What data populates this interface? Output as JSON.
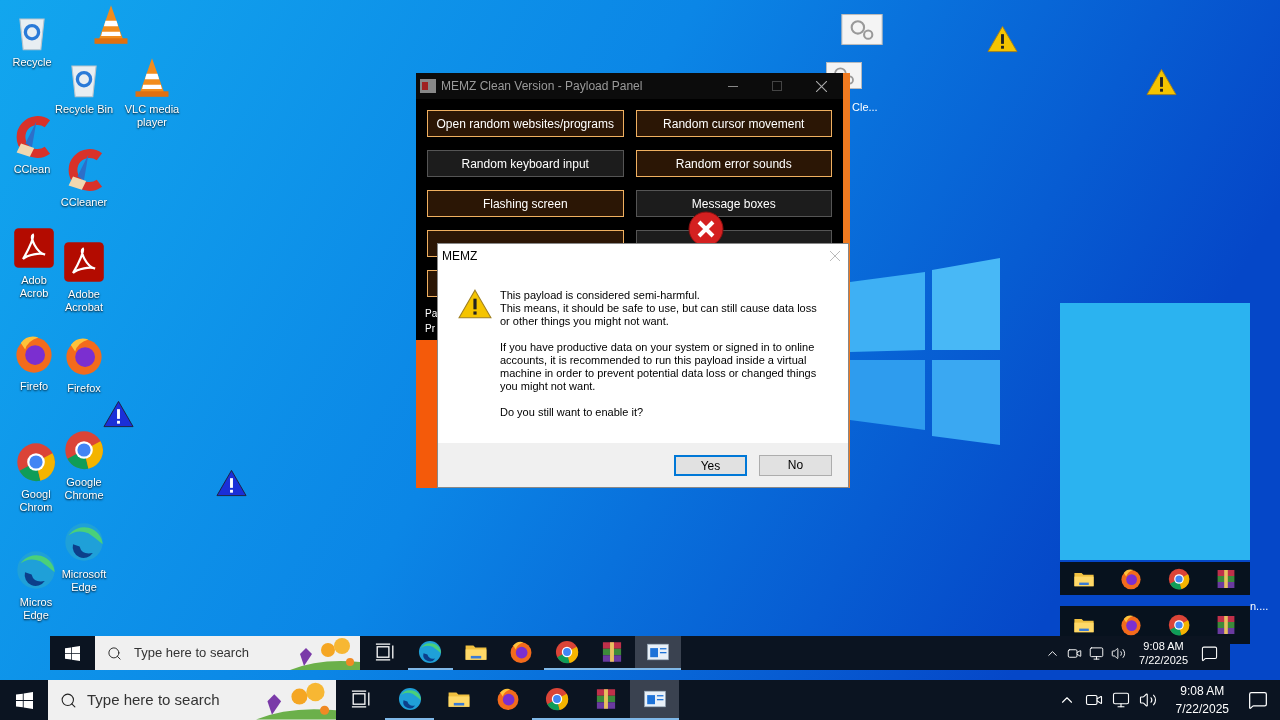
{
  "desktop_icons": [
    {
      "kind": "recycle",
      "label": "Recycle"
    },
    {
      "kind": "cone"
    },
    {
      "kind": "recycle",
      "label": "Recycle Bin"
    },
    {
      "kind": "cone",
      "label": "VLC media\nplayer"
    },
    {
      "kind": "brush",
      "label": "CClean"
    },
    {
      "kind": "brush",
      "label": "CCleaner"
    },
    {
      "kind": "pdf",
      "label": "Adob\nAcrob"
    },
    {
      "kind": "pdf",
      "label": "Adobe\nAcrobat"
    },
    {
      "kind": "firefox",
      "label": "Firefo"
    },
    {
      "kind": "firefox",
      "label": "Firefox"
    },
    {
      "kind": "chrome",
      "label": "Googl\nChrom"
    },
    {
      "kind": "chrome",
      "label": "Google\nChrome"
    },
    {
      "kind": "edge",
      "label": "Micros\nEdge"
    },
    {
      "kind": "edge",
      "label": "Microsoft\nEdge"
    }
  ],
  "thumbnail_label": "Cle...",
  "payload_panel": {
    "title": "MEMZ Clean Version - Payload Panel",
    "buttons": [
      {
        "label": "Open random websites/programs",
        "selected": true
      },
      {
        "label": "Random cursor movement",
        "selected": true
      },
      {
        "label": "Random keyboard input",
        "selected": false
      },
      {
        "label": "Random error sounds",
        "selected": true
      },
      {
        "label": "Flashing screen",
        "selected": true
      },
      {
        "label": "Message boxes",
        "selected": false
      },
      {
        "selected": true
      },
      {
        "selected": false
      },
      {
        "selected": true
      }
    ],
    "status_lines": [
      "Pa",
      "Pr"
    ]
  },
  "dialog": {
    "title": "MEMZ",
    "paragraphs": [
      "This payload is considered semi-harmful.\nThis means, it should be safe to use, but can still cause data loss or other things you might not want.",
      "If you have productive data on your system or signed in to online accounts, it is recommended to run this payload inside a virtual machine in order to prevent potential data loss or changed things you might not want.",
      "Do you still want to enable it?"
    ],
    "buttons": [
      {
        "label": "Yes",
        "focused": true
      },
      {
        "label": "No",
        "focused": false
      }
    ]
  },
  "ghost_strips": [
    {
      "apps": [
        {
          "kind": "folder"
        },
        {
          "kind": "firefox"
        },
        {
          "kind": "chrome"
        },
        {
          "kind": "winrar"
        }
      ]
    },
    {
      "apps": [
        {
          "kind": "folder"
        },
        {
          "kind": "firefox"
        },
        {
          "kind": "chrome"
        },
        {
          "kind": "winrar"
        }
      ]
    }
  ],
  "ghost_strip_label": "n....",
  "ghost_taskbar": {
    "search_placeholder": "Type here to search",
    "apps": [
      {
        "kind": "taskview",
        "running": false,
        "active": false
      },
      {
        "kind": "edge",
        "running": true,
        "active": false
      },
      {
        "kind": "folder",
        "running": false,
        "active": false
      },
      {
        "kind": "firefox",
        "running": false,
        "active": false
      },
      {
        "kind": "chrome",
        "running": true,
        "active": false
      },
      {
        "kind": "winrar",
        "running": true,
        "active": false
      },
      {
        "kind": "memz",
        "running": true,
        "active": true
      }
    ],
    "time": "9:08 AM",
    "date": "7/22/2025"
  },
  "taskbar": {
    "search_placeholder": "Type here to search",
    "apps": [
      {
        "kind": "taskview",
        "running": false,
        "active": false
      },
      {
        "kind": "edge",
        "running": true,
        "active": false
      },
      {
        "kind": "folder",
        "running": false,
        "active": false
      },
      {
        "kind": "firefox",
        "running": false,
        "active": false
      },
      {
        "kind": "chrome",
        "running": true,
        "active": false
      },
      {
        "kind": "winrar",
        "running": true,
        "active": false
      },
      {
        "kind": "memz",
        "running": true,
        "active": true
      }
    ],
    "time": "9:08 AM",
    "date": "7/22/2025"
  }
}
